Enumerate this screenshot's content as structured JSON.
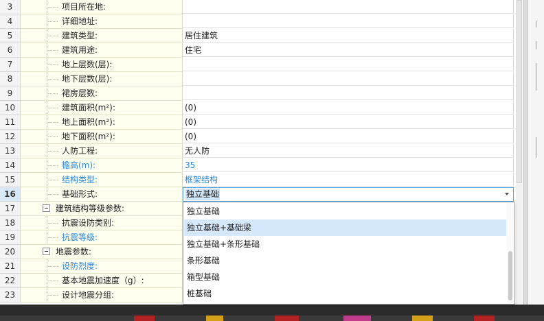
{
  "rows": [
    {
      "num": "3",
      "label": "项目所在地:",
      "value": "",
      "blue": false
    },
    {
      "num": "4",
      "label": "详细地址:",
      "value": "",
      "blue": false
    },
    {
      "num": "5",
      "label": "建筑类型:",
      "value": "居住建筑",
      "blue": false
    },
    {
      "num": "6",
      "label": "建筑用途:",
      "value": "住宅",
      "blue": false
    },
    {
      "num": "7",
      "label": "地上层数(层):",
      "value": "",
      "blue": false
    },
    {
      "num": "8",
      "label": "地下层数(层):",
      "value": "",
      "blue": false
    },
    {
      "num": "9",
      "label": "裙房层数:",
      "value": "",
      "blue": false
    },
    {
      "num": "10",
      "label": "建筑面积(m²):",
      "value": "(0)",
      "blue": false
    },
    {
      "num": "11",
      "label": "地上面积(m²):",
      "value": "(0)",
      "blue": false
    },
    {
      "num": "12",
      "label": "地下面积(m²):",
      "value": "(0)",
      "blue": false
    },
    {
      "num": "13",
      "label": "人防工程:",
      "value": "无人防",
      "blue": false
    },
    {
      "num": "14",
      "label": "檐高(m):",
      "value": "35",
      "blue": true
    },
    {
      "num": "15",
      "label": "结构类型:",
      "value": "框架结构",
      "blue": true
    },
    {
      "num": "16",
      "label": "基础形式:",
      "value": "独立基础",
      "blue": false,
      "current": true
    },
    {
      "num": "17",
      "label": "建筑结构等级参数:",
      "value": "",
      "blue": false,
      "group": true
    },
    {
      "num": "18",
      "label": "抗震设防类别:",
      "value": "",
      "blue": false
    },
    {
      "num": "19",
      "label": "抗震等级:",
      "value": "",
      "blue": true
    },
    {
      "num": "20",
      "label": "地震参数:",
      "value": "",
      "blue": false,
      "group": true
    },
    {
      "num": "21",
      "label": "设防烈度:",
      "value": "",
      "blue": true
    },
    {
      "num": "22",
      "label": "基本地震加速度（g）:",
      "value": "",
      "blue": false
    },
    {
      "num": "23",
      "label": "设计地震分组:",
      "value": "",
      "blue": false
    }
  ],
  "combo": {
    "value": "独立基础",
    "arrow_icon": "chevron-down-icon"
  },
  "dropdown": {
    "options": [
      "独立基础",
      "独立基础+基础梁",
      "独立基础+条形基础",
      "条形基础",
      "箱型基础",
      "桩基础"
    ],
    "highlighted_index": 1
  },
  "colors": {
    "label_bg": "#fffff0",
    "blue_text": "#2a87d4",
    "selection": "#d6e8fb",
    "focus_border": "#5c9fd8"
  }
}
